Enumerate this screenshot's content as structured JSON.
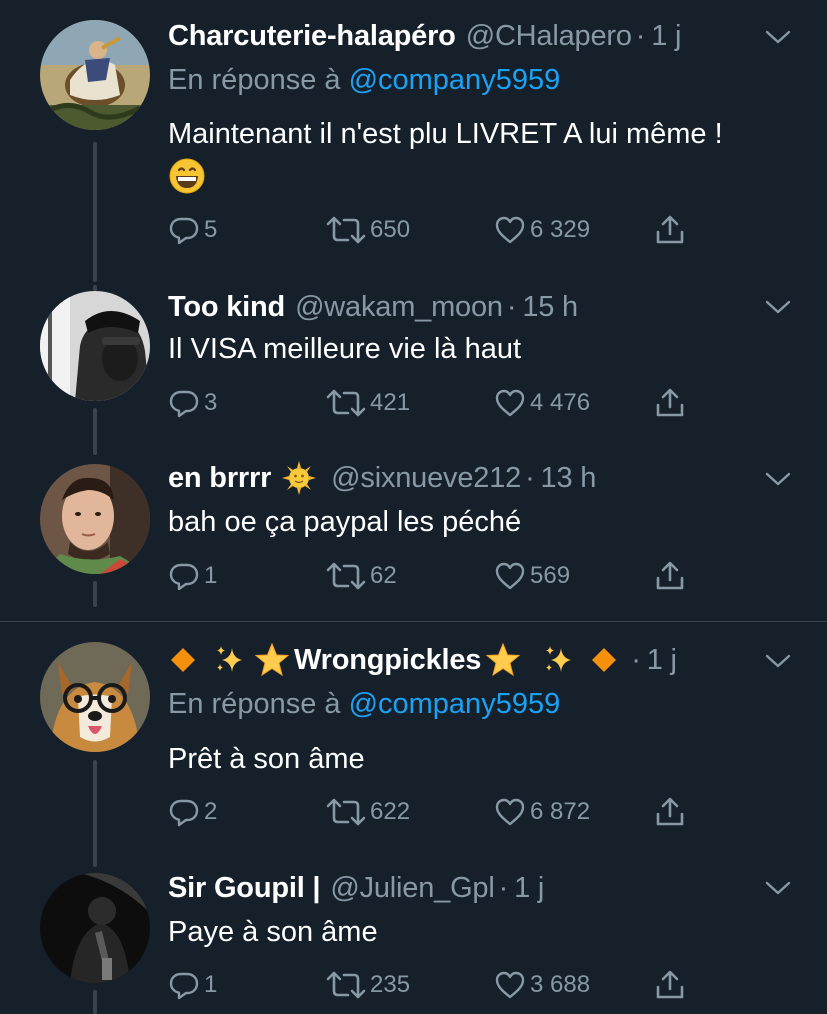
{
  "colors": {
    "background": "#15202b",
    "secondary_text": "#8899a6",
    "link": "#1da1f2",
    "line": "#38444d"
  },
  "tweets": [
    {
      "name": "Charcuterie-halapéro",
      "handle": "@CHalapero",
      "dot": "·",
      "time": "1 j",
      "reply_prefix": "En réponse à",
      "reply_mention": "@company5959",
      "text_line1": "Maintenant il n'est plu LIVRET A lui même !",
      "emoji": "grinning-face-emoji",
      "replies": "5",
      "retweets": "650",
      "likes": "6 329"
    },
    {
      "name": "Too kind",
      "handle": "@wakam_moon",
      "dot": "·",
      "time": "15 h",
      "text": "Il VISA meilleure vie là haut",
      "replies": "3",
      "retweets": "421",
      "likes": "4 476"
    },
    {
      "name": "en brrrr",
      "name_emoji": "sun-face-emoji",
      "handle": "@sixnueve212",
      "dot": "·",
      "time": "13 h",
      "text": "bah oe ça paypal les péché",
      "replies": "1",
      "retweets": "62",
      "likes": "569"
    },
    {
      "name": "Wrongpickles",
      "name_emojis": [
        "orange-diamond-emoji",
        "sparkles-emoji",
        "star-emoji"
      ],
      "dot": "·",
      "time": "1 j",
      "reply_prefix": "En réponse à",
      "reply_mention": "@company5959",
      "text": "Prêt à son âme",
      "replies": "2",
      "retweets": "622",
      "likes": "6 872"
    },
    {
      "name": "Sir Goupil |",
      "handle": "@Julien_Gpl",
      "dot": "·",
      "time": "1 j",
      "text": "Paye à son âme",
      "replies": "1",
      "retweets": "235",
      "likes": "3 688"
    }
  ]
}
